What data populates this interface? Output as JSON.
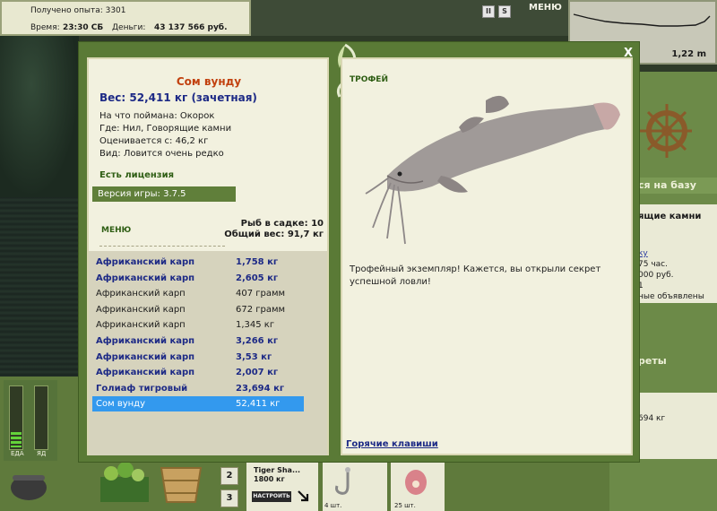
{
  "status": {
    "experience": "Получено опыта: 3301",
    "time_label": "Время:",
    "time_value": "23:30 СБ",
    "money_label": "Деньги:",
    "money_value": "43 137 566 руб."
  },
  "top_icons": {
    "pause": "II",
    "sound": "S",
    "menu": "МЕНЮ"
  },
  "depth": "1,22 m",
  "dialog": {
    "close": "X",
    "fish_name": "Сом вунду",
    "weight": "Вес: 52,411 кг (зачетная)",
    "info": [
      "На что поймана: Окорок",
      "Где: Нил, Говорящие камни",
      "Оценивается с: 46,2 кг",
      "Вид: Ловится очень редко"
    ],
    "license": "Есть лицензия",
    "version": "Версия игры: 3.7.5",
    "menu": "МЕНЮ",
    "fish_count": "Рыб в садке: 10",
    "total_weight": "Общий вес: 91,7 кг",
    "catches": [
      {
        "name": "Африканский карп",
        "weight": "1,758 кг",
        "style": "big"
      },
      {
        "name": "Африканский карп",
        "weight": "2,605 кг",
        "style": "big"
      },
      {
        "name": "Африканский карп",
        "weight": "407 грамм",
        "style": "normal"
      },
      {
        "name": "Африканский карп",
        "weight": "672 грамм",
        "style": "normal"
      },
      {
        "name": "Африканский карп",
        "weight": "1,345 кг",
        "style": "normal"
      },
      {
        "name": "Африканский карп",
        "weight": "3,266 кг",
        "style": "big"
      },
      {
        "name": "Африканский карп",
        "weight": "3,53 кг",
        "style": "big"
      },
      {
        "name": "Африканский карп",
        "weight": "2,007 кг",
        "style": "big"
      },
      {
        "name": "Голиаф тигровый",
        "weight": "23,694 кг",
        "style": "big"
      },
      {
        "name": "Сом вунду",
        "weight": "52,411 кг",
        "style": "selected"
      }
    ],
    "trophy_label": "ТРОФЕЙ",
    "trophy_text": "Трофейный экземпляр! Кажется, вы открыли секрет успешной ловли!",
    "hotkeys": "Горячие клавиши"
  },
  "right_panel": {
    "base": "ся на базу",
    "place": "ящие камни",
    "link": "ку",
    "line1": "75 час.",
    "line2": "000 руб.",
    "line3": "1",
    "line4": "ные объявлены",
    "secrets": "реты",
    "bottom": "694 кг"
  },
  "bottom": {
    "gauge_food": "ЕДА",
    "gauge_alcohol": "ЯД",
    "btn2": "2",
    "btn3": "3",
    "tiger_name": "Tiger Sha...",
    "tiger_weight": "1800 кг",
    "setup": "НАСТРОИТЬ",
    "hook_count": "4 шт.",
    "bait_count": "25 шт."
  }
}
